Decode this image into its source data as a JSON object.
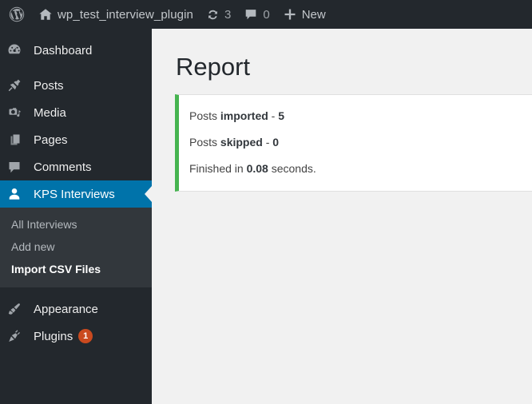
{
  "adminbar": {
    "wp_logo_icon": "wordpress-logo-icon",
    "home_icon": "home-icon",
    "site_name": "wp_test_interview_plugin",
    "updates_icon": "updates-icon",
    "updates_count": "3",
    "comments_icon": "comment-bubble-icon",
    "comments_count": "0",
    "new_icon": "plus-icon",
    "new_label": "New"
  },
  "sidebar": {
    "items": [
      {
        "label": "Dashboard",
        "icon": "dashboard-icon",
        "current": false
      },
      {
        "label": "Posts",
        "icon": "pushpin-icon",
        "current": false
      },
      {
        "label": "Media",
        "icon": "media-icon",
        "current": false
      },
      {
        "label": "Pages",
        "icon": "pages-icon",
        "current": false
      },
      {
        "label": "Comments",
        "icon": "comment-bubble-icon",
        "current": false
      },
      {
        "label": "KPS Interviews",
        "icon": "user-icon",
        "current": true
      },
      {
        "label": "Appearance",
        "icon": "paintbrush-icon",
        "current": false
      },
      {
        "label": "Plugins",
        "icon": "plug-icon",
        "current": false,
        "badge": "1"
      }
    ],
    "submenu": [
      {
        "label": "All Interviews",
        "current": false
      },
      {
        "label": "Add new",
        "current": false
      },
      {
        "label": "Import CSV Files",
        "current": true
      }
    ]
  },
  "main": {
    "title": "Report",
    "notice": {
      "accent_color": "#46b450",
      "lines": [
        {
          "prefix": "Posts ",
          "strong1": "imported",
          "middle": " - ",
          "strong2": "5",
          "suffix": ""
        },
        {
          "prefix": "Posts ",
          "strong1": "skipped",
          "middle": " - ",
          "strong2": "0",
          "suffix": ""
        },
        {
          "prefix": "Finished in ",
          "strong1": "0.08",
          "middle": " ",
          "strong2": "",
          "suffix": "seconds."
        }
      ]
    }
  },
  "colors": {
    "admin_bar_bg": "#23282d",
    "sidebar_bg": "#23282d",
    "submenu_bg": "#32373c",
    "active_blue": "#0073aa",
    "content_bg": "#f1f1f1",
    "success_green": "#46b450",
    "badge_orange": "#ca4a1f"
  }
}
